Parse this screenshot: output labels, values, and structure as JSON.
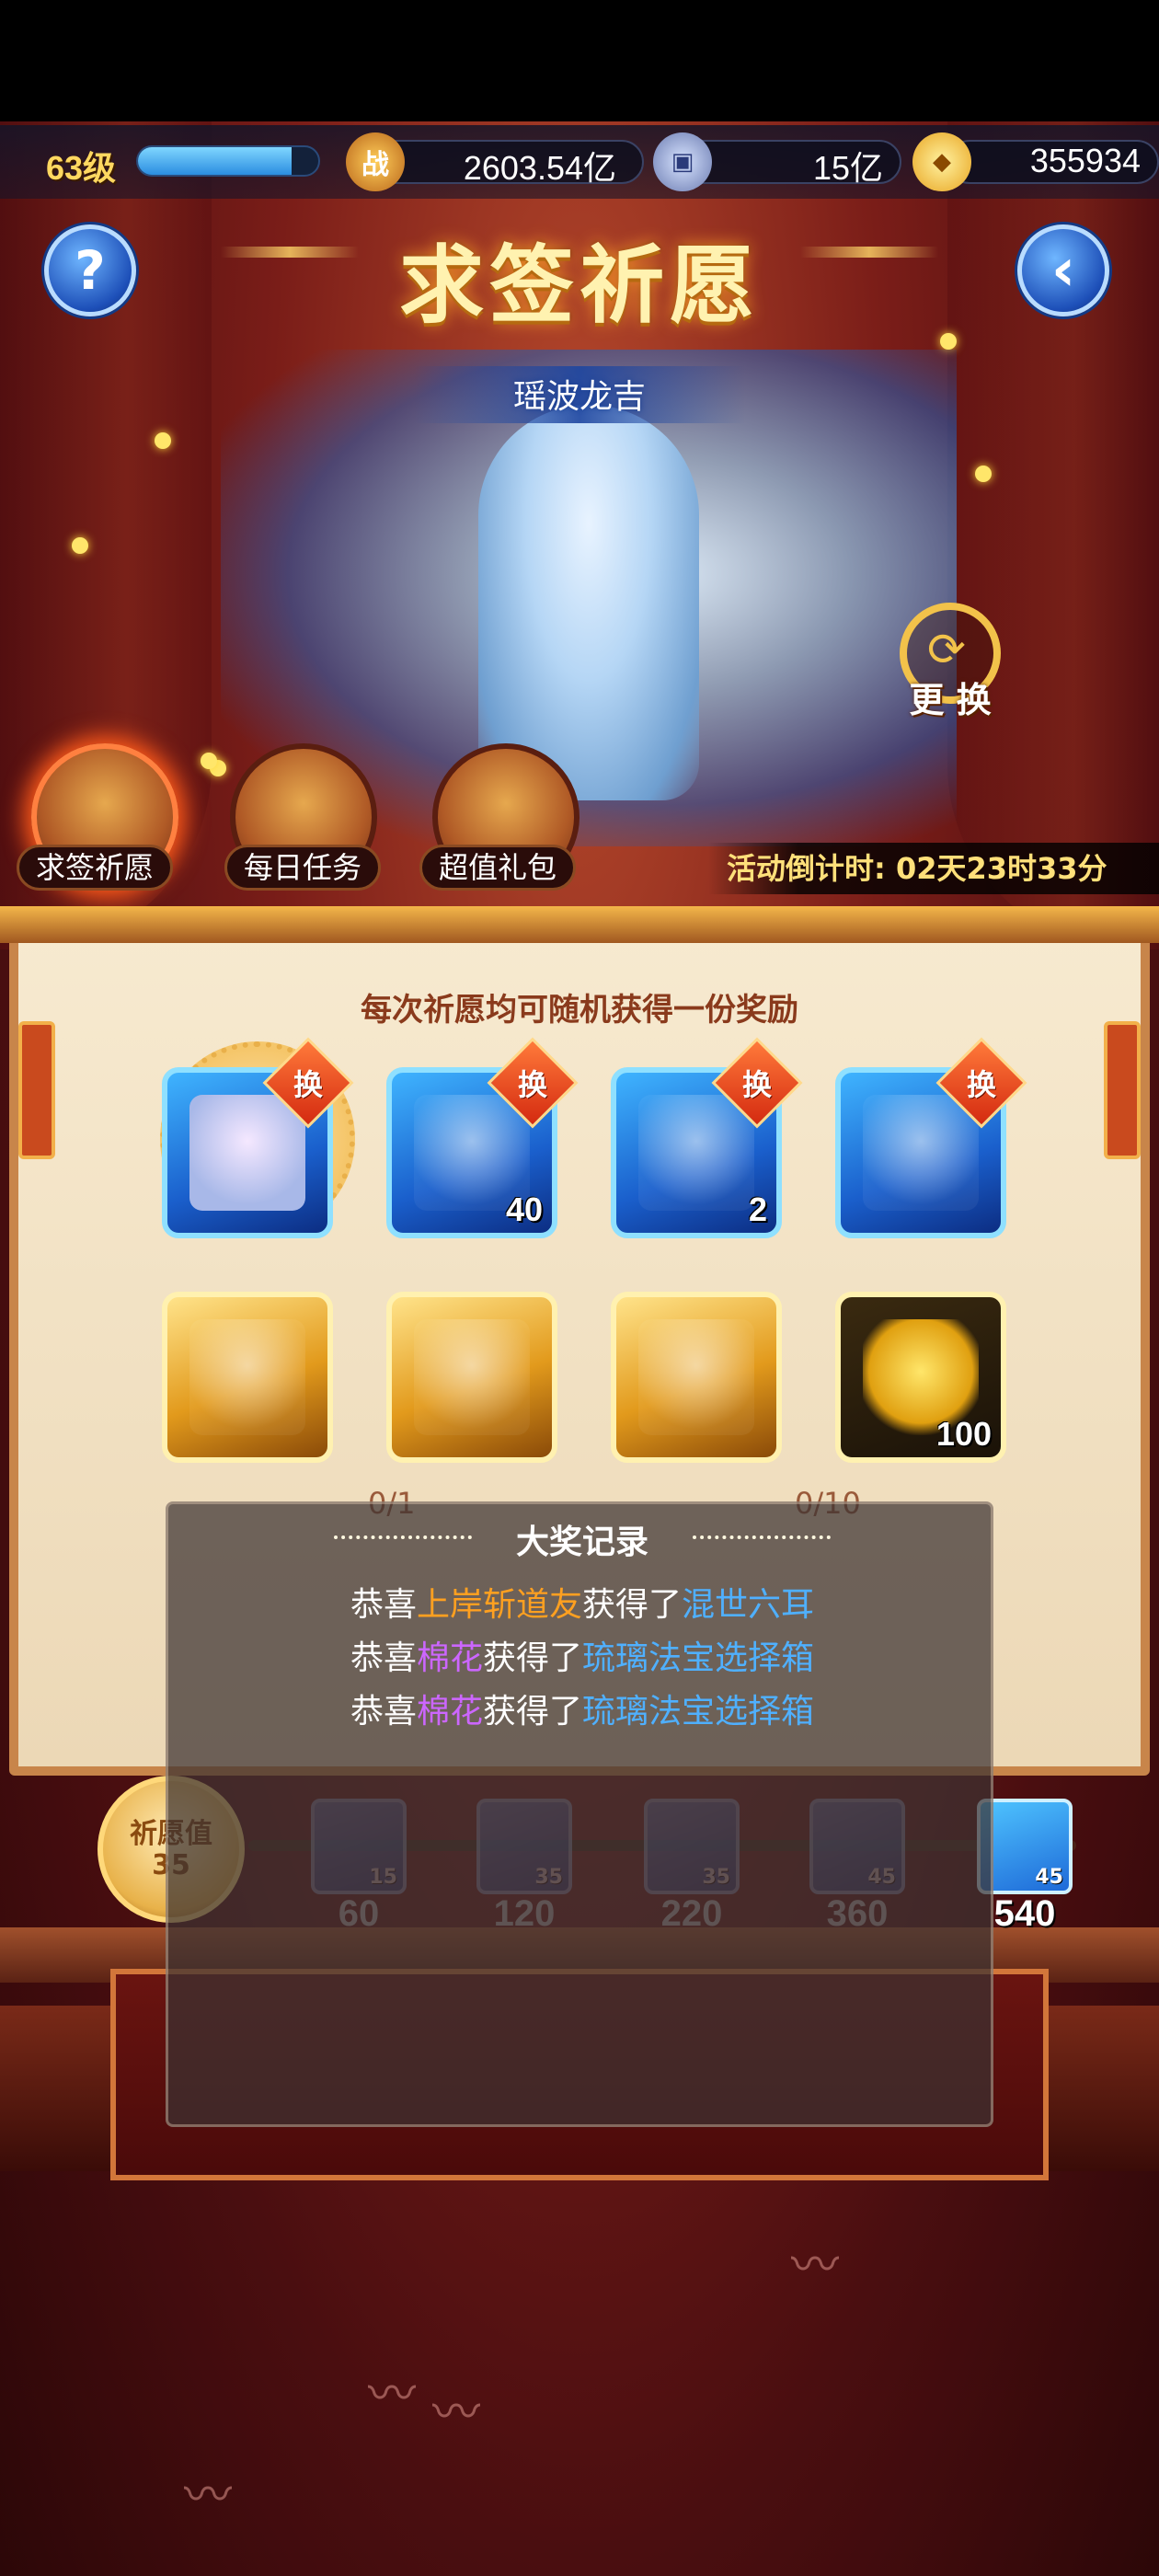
{
  "status_bar": {},
  "resources": {
    "level": "63级",
    "level_progress": 0.85,
    "power_icon": "战",
    "power": "2603.54亿",
    "coin": "15亿",
    "ingot": "355934"
  },
  "header": {
    "title": "求签祈愿",
    "help_icon": "?",
    "back_icon": "back-arrow-icon"
  },
  "hero": {
    "name": "瑶波龙吉",
    "change_label": "更 换"
  },
  "tabs": [
    {
      "label": "求签祈愿",
      "active": true
    },
    {
      "label": "每日任务",
      "active": false
    },
    {
      "label": "超值礼包",
      "active": false
    }
  ],
  "countdown": "活动倒计时: 02天23时33分",
  "panel": {
    "subtitle": "每次祈愿均可随机获得一份奖励",
    "row1": [
      {
        "type": "hero",
        "count": "",
        "swap": "换"
      },
      {
        "type": "chest",
        "count": "40",
        "swap": "换"
      },
      {
        "type": "box",
        "count": "2",
        "swap": "换"
      },
      {
        "type": "box",
        "count": "",
        "swap": "换"
      }
    ],
    "row2": [
      {
        "type": "gold-chest",
        "count": ""
      },
      {
        "type": "gold-card",
        "count": ""
      },
      {
        "type": "gold-chest2",
        "count": ""
      },
      {
        "type": "ingots",
        "count": "100"
      }
    ],
    "progress_left": "0/1",
    "progress_right": "0/10"
  },
  "record": {
    "title": "大奖记录",
    "lines": [
      {
        "prefix": "恭喜",
        "name": "上岸斩道友",
        "mid": "获得了",
        "item": "混世六耳",
        "name_color": "orange"
      },
      {
        "prefix": "恭喜",
        "name": "棉花",
        "mid": "获得了",
        "item": "琉璃法宝选择箱",
        "name_color": "purple"
      },
      {
        "prefix": "恭喜",
        "name": "棉花",
        "mid": "获得了",
        "item": "琉璃法宝选择箱",
        "name_color": "purple"
      }
    ]
  },
  "wish": {
    "label": "祈愿值",
    "value": "35",
    "milestones": [
      {
        "badge": "15",
        "target": "60",
        "on": false
      },
      {
        "badge": "35",
        "target": "120",
        "on": false
      },
      {
        "badge": "35",
        "target": "220",
        "on": false
      },
      {
        "badge": "45",
        "target": "360",
        "on": false
      },
      {
        "badge": "45",
        "target": "540",
        "on": true
      }
    ]
  },
  "colors": {
    "accent_gold": "#ffd860",
    "orange_name": "#ffa020",
    "purple_name": "#cc66ff",
    "blue_item": "#4fb0ff"
  }
}
